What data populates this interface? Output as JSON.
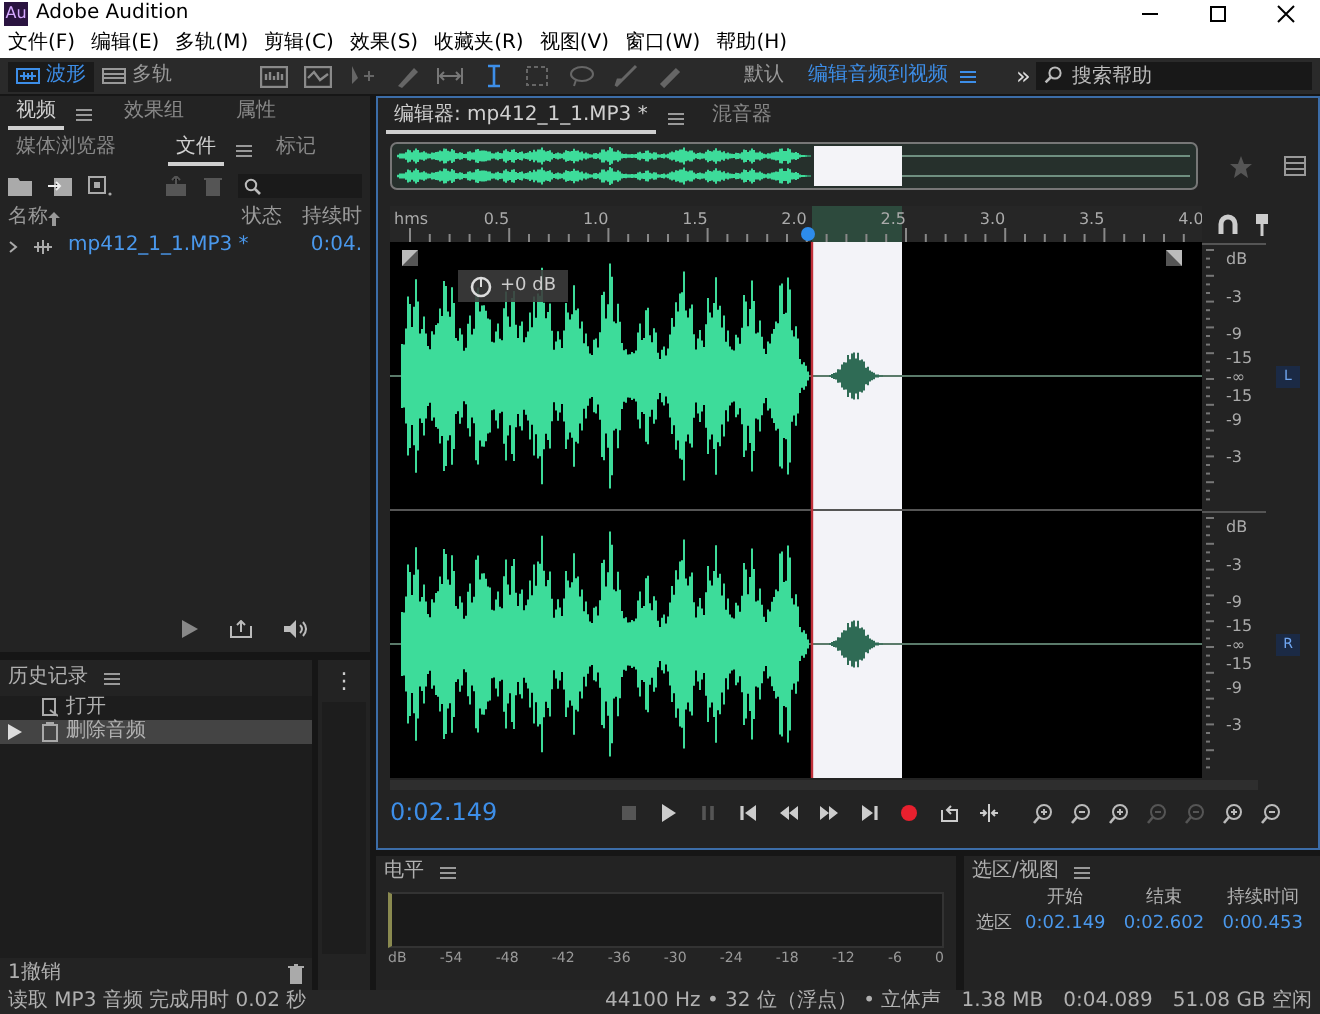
{
  "window": {
    "title": "Adobe Audition",
    "app_icon": "Au"
  },
  "menu": [
    "文件(F)",
    "编辑(E)",
    "多轨(M)",
    "剪辑(C)",
    "效果(S)",
    "收藏夹(R)",
    "视图(V)",
    "窗口(W)",
    "帮助(H)"
  ],
  "toolbar": {
    "modes": [
      {
        "label": "波形",
        "selected": true
      },
      {
        "label": "多轨",
        "selected": false
      }
    ],
    "workspaces": [
      {
        "label": "默认",
        "selected": false
      },
      {
        "label": "编辑音频到视频",
        "selected": true
      }
    ],
    "more": "»",
    "search": {
      "placeholder": "搜索帮助"
    }
  },
  "left_panel": {
    "tabs": [
      {
        "label": "视频",
        "selected": true
      },
      {
        "label": "效果组",
        "selected": false
      },
      {
        "label": "属性",
        "selected": false
      }
    ],
    "subtabs": [
      {
        "label": "媒体浏览器",
        "selected": false
      },
      {
        "label": "文件",
        "selected": true
      },
      {
        "label": "标记",
        "selected": false
      }
    ],
    "columns": [
      "名称",
      "状态",
      "持续时"
    ],
    "files": [
      {
        "name": "mp412_1_1.MP3 *",
        "duration": "0:04."
      }
    ]
  },
  "history": {
    "title": "历史记录",
    "items": [
      {
        "label": "打开",
        "selected": false
      },
      {
        "label": "删除音频",
        "selected": true
      }
    ],
    "footer": "1撤销",
    "side_label": "⋮"
  },
  "editor": {
    "tabs": [
      {
        "label": "编辑器: mp412_1_1.MP3 *",
        "selected": true
      },
      {
        "label": "混音器",
        "selected": false
      }
    ],
    "ruler": [
      "hms",
      "0.5",
      "1.0",
      "1.5",
      "2.0",
      "2.5",
      "3.0",
      "3.5",
      "4.0"
    ],
    "hud_gain": "+0 dB",
    "channels": [
      {
        "label": "L",
        "scale": [
          "dB",
          "-3",
          "-9",
          "-15",
          "-∞",
          "-15",
          "-9",
          "-3"
        ]
      },
      {
        "label": "R",
        "scale": [
          "dB",
          "-3",
          "-9",
          "-15",
          "-∞",
          "-15",
          "-9",
          "-3"
        ]
      }
    ],
    "time": "0:02.149"
  },
  "levels": {
    "title": "电平",
    "scale": [
      "dB",
      "-54",
      "-48",
      "-42",
      "-36",
      "-30",
      "-24",
      "-18",
      "-12",
      "-6",
      "0"
    ]
  },
  "selection_view": {
    "title": "选区/视图",
    "headers": [
      "开始",
      "结束",
      "持续时间"
    ],
    "rows": [
      {
        "label": "选区",
        "values": [
          "0:02.149",
          "0:02.602",
          "0:00.453"
        ]
      }
    ]
  },
  "status_bar": {
    "message": "读取 MP3 音频 完成用时 0.02 秒",
    "format": "44100 Hz • 32 位（浮点） • 立体声",
    "size": "1.38 MB",
    "duration": "0:04.089",
    "free": "51.08 GB 空闲"
  }
}
